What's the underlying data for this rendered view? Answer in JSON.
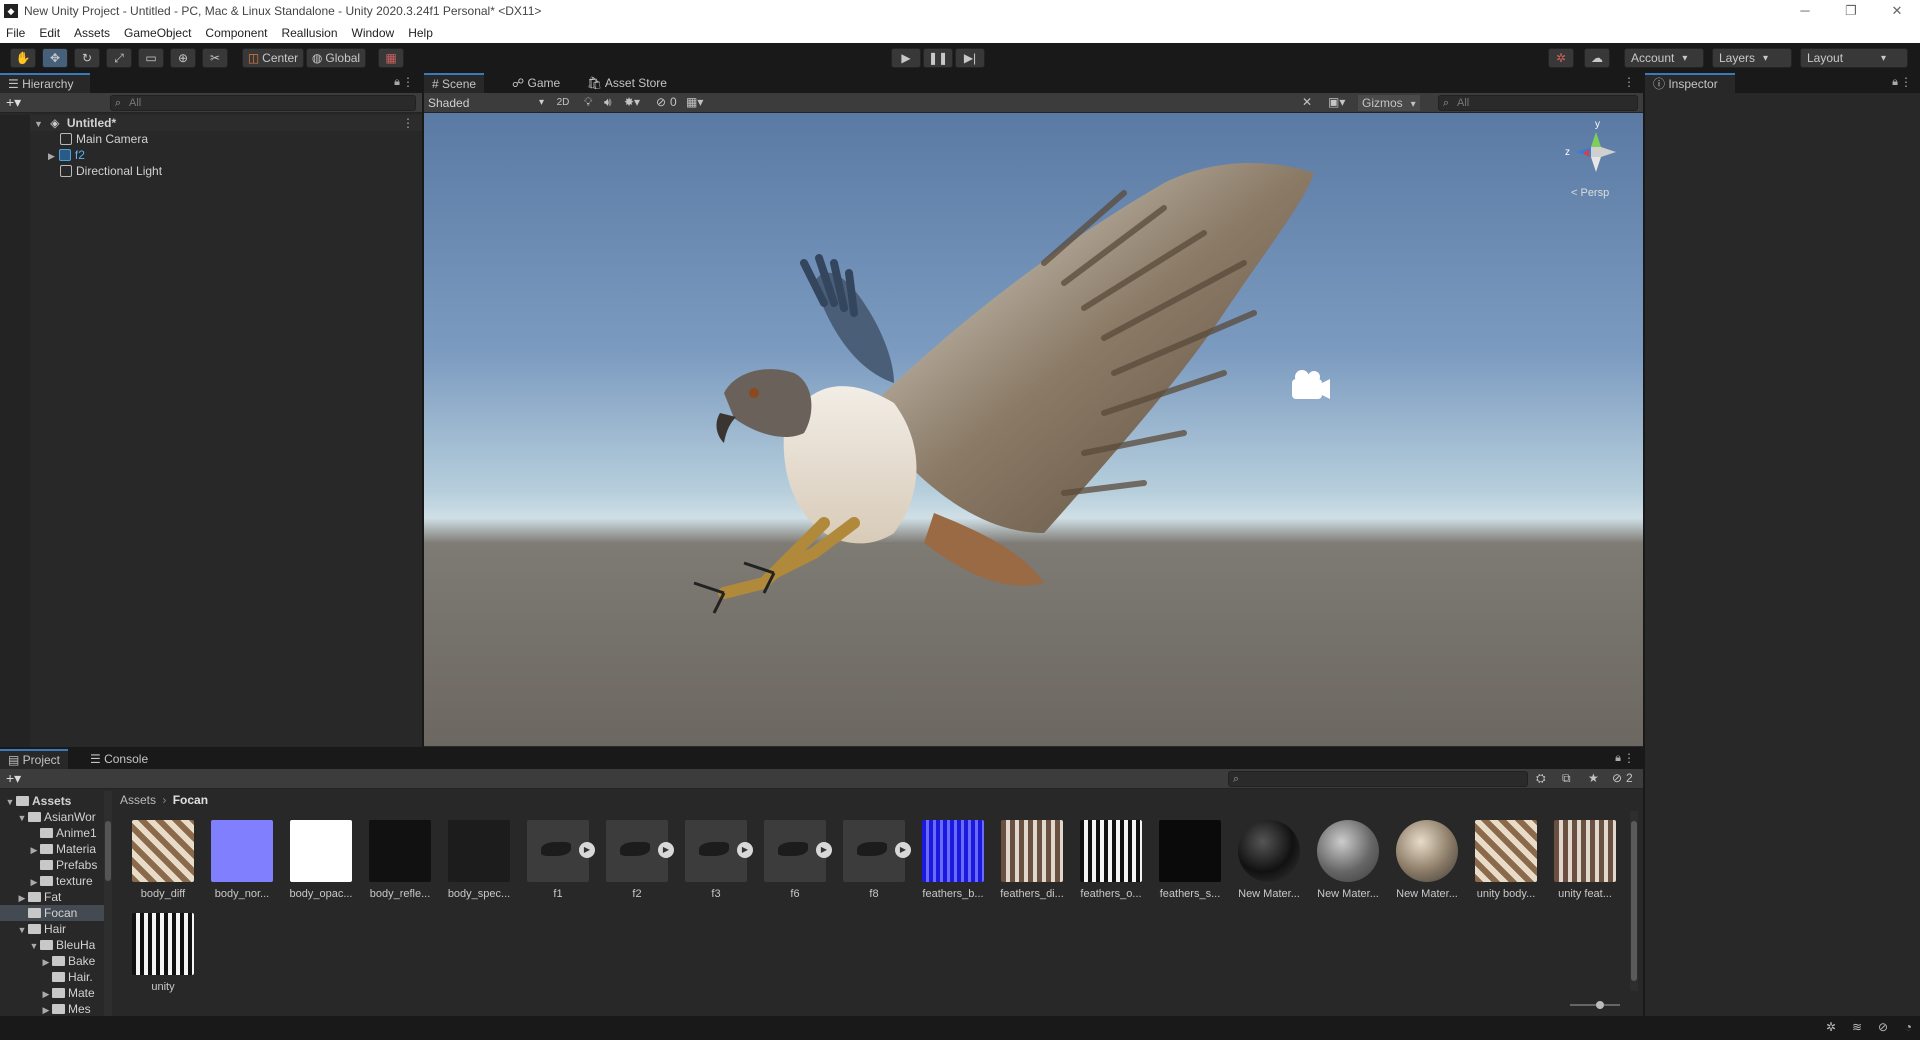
{
  "window": {
    "title": "New Unity Project - Untitled - PC, Mac & Linux Standalone - Unity 2020.3.24f1 Personal* <DX11>",
    "controls": [
      "─",
      "❐",
      "✕"
    ]
  },
  "menu": [
    "File",
    "Edit",
    "Assets",
    "GameObject",
    "Component",
    "Reallusion",
    "Window",
    "Help"
  ],
  "toolbar": {
    "pivot_label": "Center",
    "space_label": "Global",
    "account_label": "Account",
    "layers_label": "Layers",
    "layout_label": "Layout"
  },
  "hierarchy": {
    "tab": "Hierarchy",
    "search_placeholder": "All",
    "scene_name": "Untitled*",
    "items": [
      "Main Camera",
      "f2",
      "Directional Light"
    ]
  },
  "scene": {
    "tabs": [
      "Scene",
      "Game",
      "Asset Store"
    ],
    "shading_mode": "Shaded",
    "mode_2d": "2D",
    "hidden_count": "0",
    "gizmos_label": "Gizmos",
    "search_placeholder": "All",
    "projection_label": "< Persp",
    "axis_y": "y",
    "axis_z": "z"
  },
  "inspector": {
    "tab": "Inspector"
  },
  "project": {
    "tabs": [
      "Project",
      "Console"
    ],
    "breadcrumb": [
      "Assets",
      "Focan"
    ],
    "hidden_count": "2",
    "tree": [
      {
        "label": "Assets",
        "indent": 0,
        "arrow": "▼",
        "bold": true
      },
      {
        "label": "AsianWor",
        "indent": 1,
        "arrow": "▼"
      },
      {
        "label": "Anime1",
        "indent": 2,
        "arrow": ""
      },
      {
        "label": "Materia",
        "indent": 2,
        "arrow": "▶"
      },
      {
        "label": "Prefabs",
        "indent": 2,
        "arrow": ""
      },
      {
        "label": "texture",
        "indent": 2,
        "arrow": "▶"
      },
      {
        "label": "Fat",
        "indent": 1,
        "arrow": "▶"
      },
      {
        "label": "Focan",
        "indent": 1,
        "arrow": "",
        "selected": true
      },
      {
        "label": "Hair",
        "indent": 1,
        "arrow": "▼"
      },
      {
        "label": "BleuHa",
        "indent": 2,
        "arrow": "▼"
      },
      {
        "label": "Bake",
        "indent": 3,
        "arrow": "▶"
      },
      {
        "label": "Hair.",
        "indent": 3,
        "arrow": ""
      },
      {
        "label": "Mate",
        "indent": 3,
        "arrow": "▶"
      },
      {
        "label": "Mes",
        "indent": 3,
        "arrow": "▶"
      }
    ],
    "assets": [
      {
        "label": "body_diff",
        "kind": "tex-body"
      },
      {
        "label": "body_nor...",
        "kind": "normal"
      },
      {
        "label": "body_opac...",
        "kind": "white"
      },
      {
        "label": "body_refle...",
        "kind": "dark"
      },
      {
        "label": "body_spec...",
        "kind": "dark2"
      },
      {
        "label": "f1",
        "kind": "anim"
      },
      {
        "label": "f2",
        "kind": "anim"
      },
      {
        "label": "f3",
        "kind": "anim"
      },
      {
        "label": "f6",
        "kind": "anim"
      },
      {
        "label": "f8",
        "kind": "anim"
      },
      {
        "label": "feathers_b...",
        "kind": "blue"
      },
      {
        "label": "feathers_di...",
        "kind": "feather"
      },
      {
        "label": "feathers_o...",
        "kind": "featherbw"
      },
      {
        "label": "feathers_s...",
        "kind": "black"
      },
      {
        "label": "New Mater...",
        "kind": "sphere-black"
      },
      {
        "label": "New Mater...",
        "kind": "sphere-grey"
      },
      {
        "label": "New Mater...",
        "kind": "sphere-tan"
      },
      {
        "label": "unity body...",
        "kind": "tex-body"
      },
      {
        "label": "unity feat...",
        "kind": "feather"
      },
      {
        "label": "unity",
        "kind": "featherbw"
      }
    ]
  }
}
